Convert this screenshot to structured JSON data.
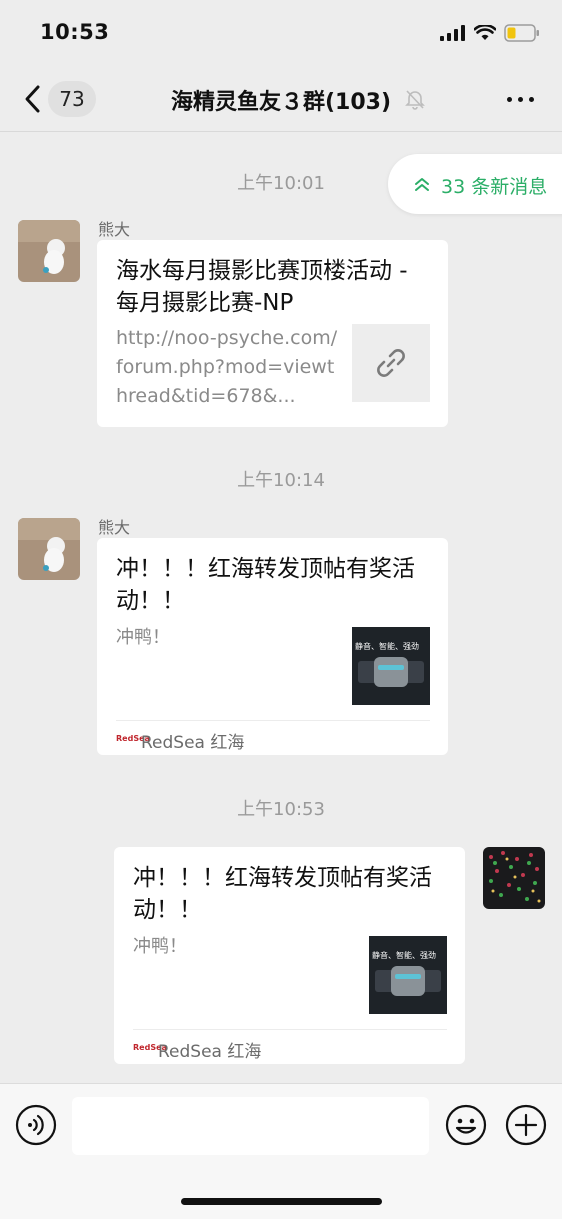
{
  "status_bar": {
    "time": "10:53"
  },
  "nav": {
    "back_count": "73",
    "title": "海精灵鱼友３群(103)"
  },
  "new_messages_pill": {
    "label": "33 条新消息"
  },
  "messages": [
    {
      "timestamp": "上午10:01",
      "sender": "熊大",
      "card_title": "海水每月摄影比赛顶楼活动 - 每月摄影比赛-NP",
      "card_url": "http://noo-psyche.com/forum.php?mod=viewthread&tid=678&...",
      "thumb_icon": "link-icon"
    },
    {
      "timestamp": "上午10:14",
      "sender": "熊大",
      "card_title": "冲！！！红海转发顶帖有奖活动！！",
      "card_desc": "冲鸭！",
      "thumb_caption": "静音、智能、强劲",
      "source_logo": "RedSea",
      "source_name": "RedSea 红海"
    },
    {
      "timestamp": "上午10:53",
      "card_title": "冲！！！红海转发顶帖有奖活动！！",
      "card_desc": "冲鸭！",
      "thumb_caption": "静音、智能、强劲",
      "source_logo": "RedSea",
      "source_name": "RedSea 红海"
    }
  ],
  "colors": {
    "background": "#ededed",
    "accent_green": "#2bae67",
    "bubble": "#ffffff"
  }
}
